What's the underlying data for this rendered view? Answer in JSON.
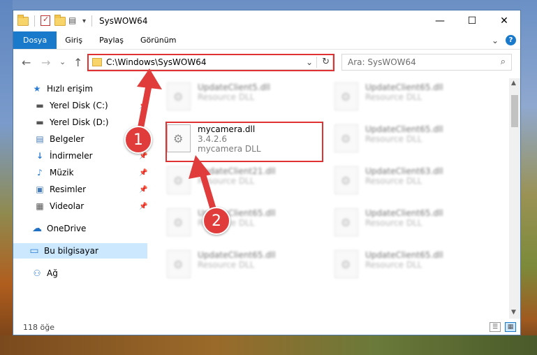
{
  "window": {
    "title": "SysWOW64",
    "controls": {
      "minimize": "—",
      "maximize": "☐",
      "close": "✕"
    }
  },
  "ribbon": {
    "tabs": [
      {
        "label": "Dosya",
        "active": true
      },
      {
        "label": "Giriş",
        "active": false
      },
      {
        "label": "Paylaş",
        "active": false
      },
      {
        "label": "Görünüm",
        "active": false
      }
    ],
    "expand": "⌄",
    "help": "?"
  },
  "nav": {
    "back": "←",
    "forward": "→",
    "recent": "⌄",
    "up": "↑"
  },
  "address": {
    "path": "C:\\Windows\\SysWOW64",
    "dropdown": "⌄",
    "refresh": "↻"
  },
  "search": {
    "placeholder": "Ara: SysWOW64",
    "icon": "⌕"
  },
  "sidebar": {
    "items": [
      {
        "label": "Hızlı erişim",
        "icon": "★",
        "icon_name": "star-icon"
      },
      {
        "label": "Yerel Disk (C:)",
        "icon": "▬",
        "icon_name": "drive-icon"
      },
      {
        "label": "Yerel Disk (D:)",
        "icon": "▬",
        "icon_name": "drive-icon"
      },
      {
        "label": "Belgeler",
        "icon": "▤",
        "icon_name": "documents-icon"
      },
      {
        "label": "İndirmeler",
        "icon": "↓",
        "icon_name": "download-icon"
      },
      {
        "label": "Müzik",
        "icon": "♪",
        "icon_name": "music-icon"
      },
      {
        "label": "Resimler",
        "icon": "▣",
        "icon_name": "pictures-icon"
      },
      {
        "label": "Videolar",
        "icon": "▦",
        "icon_name": "videos-icon"
      },
      {
        "label": "OneDrive",
        "icon": "☁",
        "icon_name": "cloud-icon"
      },
      {
        "label": "Bu bilgisayar",
        "icon": "▭",
        "icon_name": "computer-icon"
      },
      {
        "label": "Ağ",
        "icon": "⚇",
        "icon_name": "network-icon"
      }
    ],
    "pin": "📌"
  },
  "files": {
    "focused": {
      "name": "mycamera.dll",
      "version": "3.4.2.6",
      "description": "mycamera DLL"
    },
    "blurred": [
      {
        "name": "UpdateClient5.dll",
        "desc": "Resource DLL"
      },
      {
        "name": "UpdateClient65.dll",
        "desc": "Resource DLL"
      },
      {
        "name": "UpdateClient65.dll",
        "desc": "Resource DLL"
      },
      {
        "name": "UpdateClient21.dll",
        "desc": "Resource DLL"
      },
      {
        "name": "UpdateClient63.dll",
        "desc": "Resource DLL"
      },
      {
        "name": "UpdateClient65.dll",
        "desc": "Resource DLL"
      },
      {
        "name": "UpdateClient65.dll",
        "desc": "Resource DLL"
      },
      {
        "name": "UpdateClient65.dll",
        "desc": "Resource DLL"
      },
      {
        "name": "UpdateClient65.dll",
        "desc": "Resource DLL"
      }
    ]
  },
  "status": {
    "count": "118 öğe"
  },
  "annotations": {
    "step1": "1",
    "step2": "2",
    "color": "#e03232"
  }
}
